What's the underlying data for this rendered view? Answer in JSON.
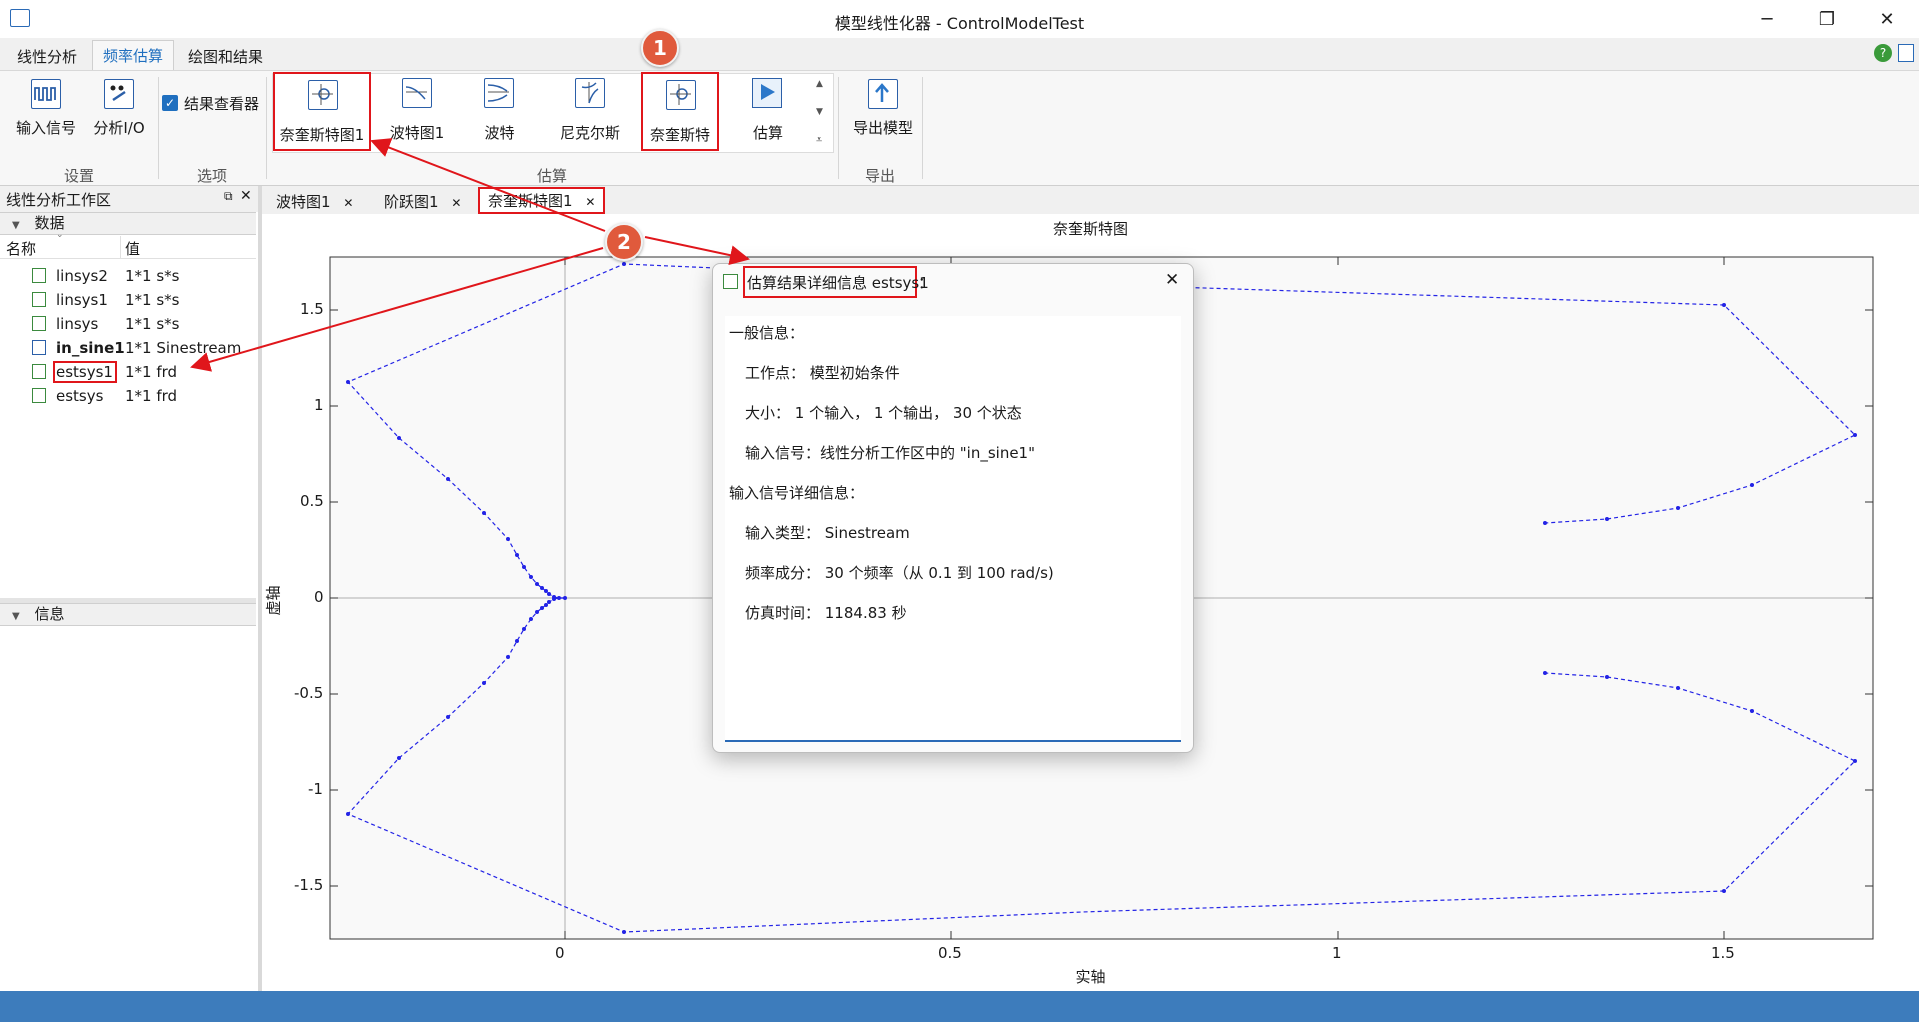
{
  "window": {
    "title": "模型线性化器 - ControlModelTest"
  },
  "ribbon": {
    "tabs": [
      "线性分析",
      "频率估算",
      "绘图和结果"
    ],
    "buttons": {
      "input_signal": "输入信号",
      "analysis_io": "分析I/O",
      "result_viewer": "结果查看器",
      "nyquist1": "奈奎斯特图1",
      "bode1": "波特图1",
      "bode": "波特",
      "nichols": "尼克尔斯",
      "nyquist": "奈奎斯特",
      "estimate": "估算",
      "export_model": "导出模型"
    },
    "groups": {
      "settings": "设置",
      "options": "选项",
      "estimate": "估算",
      "export": "导出"
    }
  },
  "workspace": {
    "title": "线性分析工作区",
    "data_header": "数据",
    "info_header": "信息",
    "columns": [
      "名称",
      "值"
    ],
    "rows": [
      {
        "name": "linsys2",
        "value": "1*1 s*s"
      },
      {
        "name": "linsys1",
        "value": "1*1 s*s"
      },
      {
        "name": "linsys",
        "value": "1*1 s*s"
      },
      {
        "name": "in_sine1",
        "value": "1*1 Sinestream"
      },
      {
        "name": "estsys1",
        "value": "1*1 frd"
      },
      {
        "name": "estsys",
        "value": "1*1 frd"
      }
    ]
  },
  "doc_tabs": [
    "波特图1",
    "阶跃图1",
    "奈奎斯特图1"
  ],
  "plot": {
    "title": "奈奎斯特图",
    "xlabel": "实轴",
    "ylabel": "虚轴",
    "xticks": [
      "0",
      "0.5",
      "1",
      "1.5"
    ],
    "yticks": [
      "1.5",
      "1",
      "0.5",
      "0",
      "-0.5",
      "-1",
      "-1.5"
    ]
  },
  "dialog": {
    "title": "估算结果详细信息 estsys1",
    "title_suffix": "：",
    "lines": [
      "一般信息：",
      "工作点：  模型初始条件",
      "大小：  1 个输入，  1 个输出，  30 个状态",
      "输入信号：线性分析工作区中的 \"in_sine1\"",
      "输入信号详细信息：",
      "输入类型：  Sinestream",
      "频率成分：  30 个频率（从 0.1 到 100 rad/s)",
      "仿真时间：  1184.83 秒"
    ]
  },
  "callouts": [
    "1",
    "2"
  ],
  "colors": {
    "accent": "#1f6fbf",
    "highlight": "#e0161b",
    "curve": "#2323e6",
    "callout": "#e05a3c",
    "status": "#3d7cbc"
  }
}
